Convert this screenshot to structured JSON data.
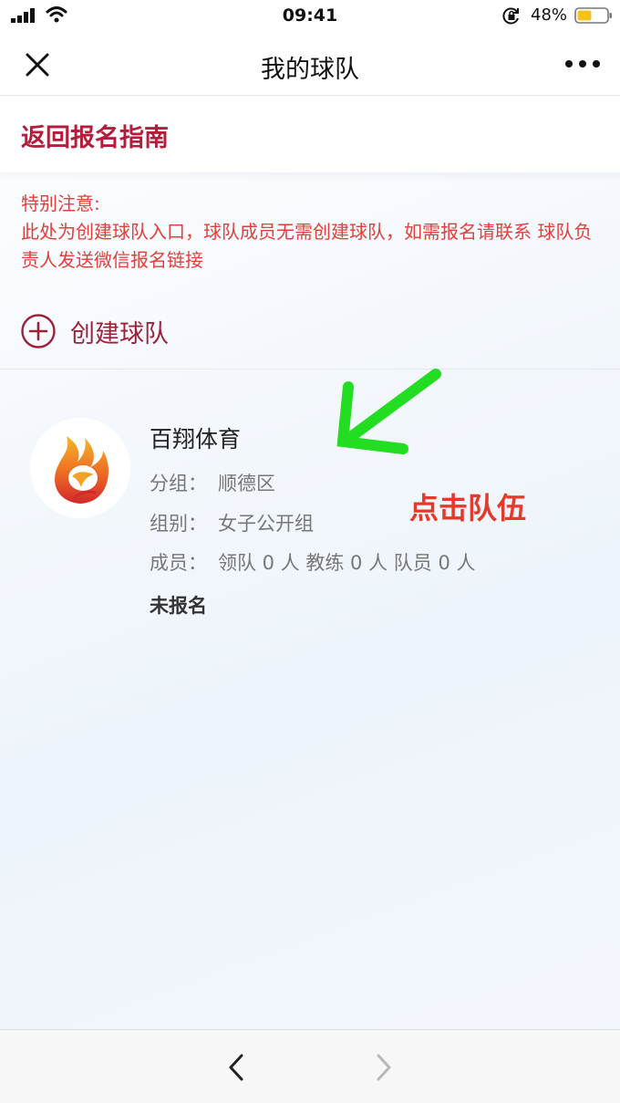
{
  "status_bar": {
    "time": "09:41",
    "battery_percent": "48%",
    "battery_level": 0.48,
    "icons": [
      "signal-icon",
      "wifi-icon",
      "lock-rotation-icon",
      "battery-icon"
    ]
  },
  "nav": {
    "title": "我的球队",
    "icons": [
      "close-icon",
      "more-icon"
    ]
  },
  "guide": {
    "link_label": "返回报名指南"
  },
  "notice": {
    "heading": "特别注意:",
    "body": "此处为创建球队入口，球队成员无需创建球队，如需报名请联系 球队负责人发送微信报名链接"
  },
  "create_team": {
    "label": "创建球队",
    "icon": "plus-circle-icon"
  },
  "team": {
    "name": "百翔体育",
    "group_label": "分组：",
    "group_value": "顺德区",
    "category_label": "组别：",
    "category_value": "女子公开组",
    "members_label": "成员：",
    "members_value": "领队 0 人  教练 0 人  队员 0 人",
    "status": "未报名",
    "logo_icon": "team-logo-icon"
  },
  "annotation": {
    "text": "点击队伍",
    "arrow_color": "#22dd22",
    "text_color": "#e43a2a"
  },
  "bottom_bar": {
    "icons": [
      "back-arrow-icon",
      "forward-arrow-icon"
    ]
  },
  "colors": {
    "brand": "#b41e3c",
    "notice": "#e0403a",
    "create": "#9a2338"
  }
}
